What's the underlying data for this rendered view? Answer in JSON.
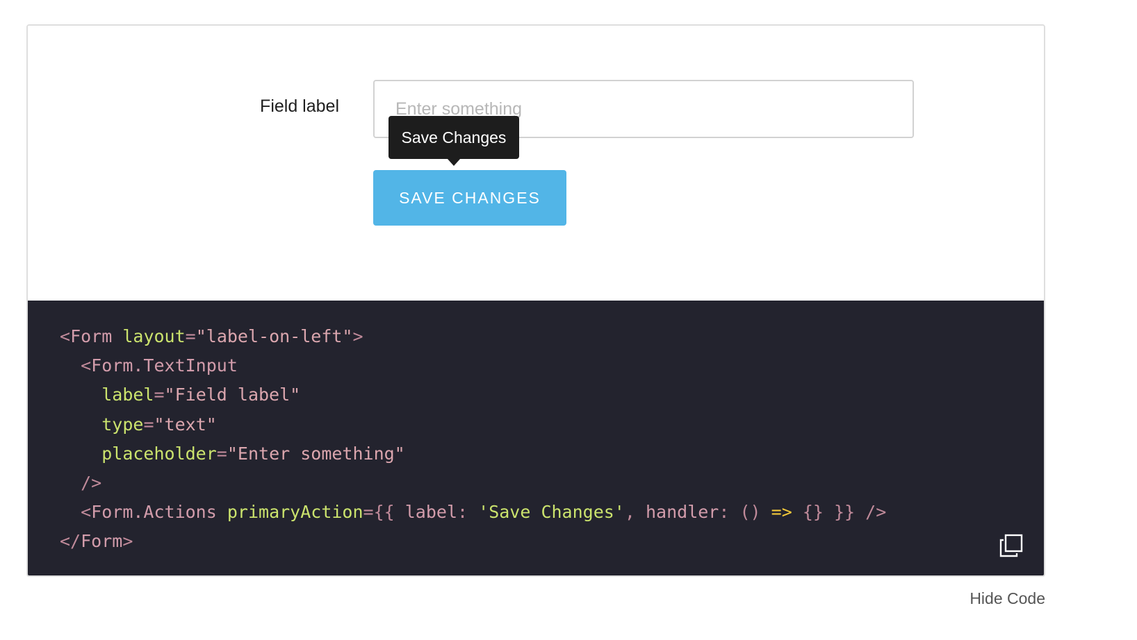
{
  "form": {
    "field_label": "Field label",
    "input_placeholder": "Enter something",
    "input_value": "",
    "tooltip_text": "Save Changes",
    "button_label": "SAVE CHANGES"
  },
  "code": {
    "lines": [
      [
        [
          "punc",
          "<"
        ],
        [
          "tag",
          "Form"
        ],
        [
          "plain",
          " "
        ],
        [
          "attr",
          "layout"
        ],
        [
          "punc",
          "="
        ],
        [
          "str",
          "\"label-on-left\""
        ],
        [
          "punc",
          ">"
        ]
      ],
      [
        [
          "plain",
          "  "
        ],
        [
          "punc",
          "<"
        ],
        [
          "tag",
          "Form.TextInput"
        ]
      ],
      [
        [
          "plain",
          "    "
        ],
        [
          "attr",
          "label"
        ],
        [
          "punc",
          "="
        ],
        [
          "str",
          "\"Field label\""
        ]
      ],
      [
        [
          "plain",
          "    "
        ],
        [
          "attr",
          "type"
        ],
        [
          "punc",
          "="
        ],
        [
          "str",
          "\"text\""
        ]
      ],
      [
        [
          "plain",
          "    "
        ],
        [
          "attr",
          "placeholder"
        ],
        [
          "punc",
          "="
        ],
        [
          "str",
          "\"Enter something\""
        ]
      ],
      [
        [
          "plain",
          "  "
        ],
        [
          "punc",
          "/>"
        ]
      ],
      [
        [
          "plain",
          "  "
        ],
        [
          "punc",
          "<"
        ],
        [
          "tag",
          "Form.Actions"
        ],
        [
          "plain",
          " "
        ],
        [
          "attr",
          "primaryAction"
        ],
        [
          "punc",
          "={{"
        ],
        [
          "plain",
          " "
        ],
        [
          "tag",
          "label"
        ],
        [
          "punc",
          ":"
        ],
        [
          "plain",
          " "
        ],
        [
          "strq",
          "'Save Changes'"
        ],
        [
          "punc",
          ","
        ],
        [
          "plain",
          " "
        ],
        [
          "tag",
          "handler"
        ],
        [
          "punc",
          ":"
        ],
        [
          "plain",
          " "
        ],
        [
          "punc",
          "()"
        ],
        [
          "plain",
          " "
        ],
        [
          "op",
          "=>"
        ],
        [
          "plain",
          " "
        ],
        [
          "punc",
          "{}"
        ],
        [
          "plain",
          " "
        ],
        [
          "punc",
          "}}"
        ],
        [
          "plain",
          " "
        ],
        [
          "punc",
          "/>"
        ]
      ],
      [
        [
          "punc",
          "</"
        ],
        [
          "tag",
          "Form"
        ],
        [
          "punc",
          ">"
        ]
      ]
    ],
    "copy_icon": "copy-icon"
  },
  "footer": {
    "toggle_label": "Hide Code"
  },
  "colors": {
    "button": "#52b5e7",
    "code_background": "#23232e",
    "tooltip_background": "#1d1d1d",
    "code_attr": "#cbe36d",
    "code_tag": "#d29cab",
    "code_operator": "#f3c93a"
  }
}
